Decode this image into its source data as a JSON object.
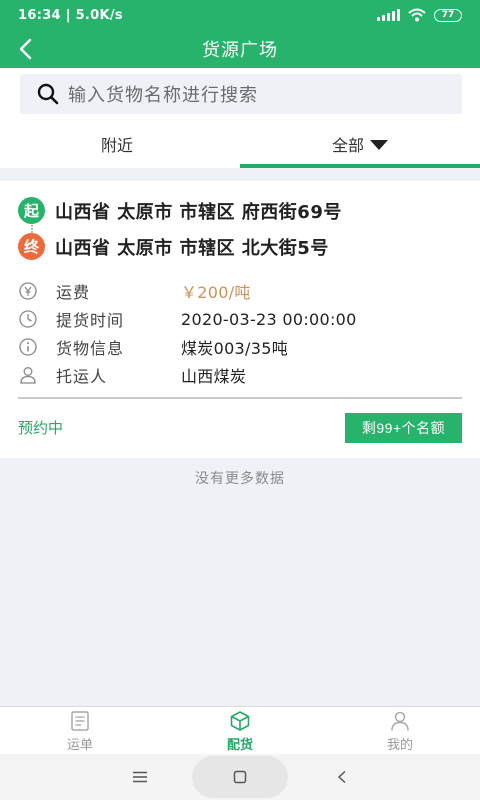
{
  "status_bar": {
    "time_speed": "16:34 | 5.0K/s",
    "battery": "77"
  },
  "header": {
    "title": "货源广场"
  },
  "search": {
    "placeholder": "输入货物名称进行搜索"
  },
  "tabs": [
    {
      "label": "附近",
      "active": false
    },
    {
      "label": "全部",
      "active": true
    }
  ],
  "cargo_card": {
    "start_badge": "起",
    "start_address": "山西省 太原市 市辖区 府西街69号",
    "end_badge": "终",
    "end_address": "山西省 太原市 市辖区 北大街5号",
    "fields": [
      {
        "icon": "yen-icon",
        "label": "运费",
        "value": "￥200/吨"
      },
      {
        "icon": "clock-icon",
        "label": "提货时间",
        "value": "2020-03-23 00:00:00"
      },
      {
        "icon": "info-icon",
        "label": "货物信息",
        "value": "煤炭003/35吨"
      },
      {
        "icon": "person-icon",
        "label": "托运人",
        "value": "山西煤炭"
      }
    ],
    "status": "预约中",
    "quota_button": "剩99+个名额"
  },
  "list_end_text": "没有更多数据",
  "bottom_nav": [
    {
      "label": "运单",
      "icon": "waybill-icon",
      "active": false
    },
    {
      "label": "配货",
      "icon": "package-icon",
      "active": true
    },
    {
      "label": "我的",
      "icon": "profile-icon",
      "active": false
    }
  ],
  "colors": {
    "brand": "#27b36b",
    "accent_orange": "#ec6b3c",
    "price": "#c9935a",
    "background": "#eef1f6"
  }
}
